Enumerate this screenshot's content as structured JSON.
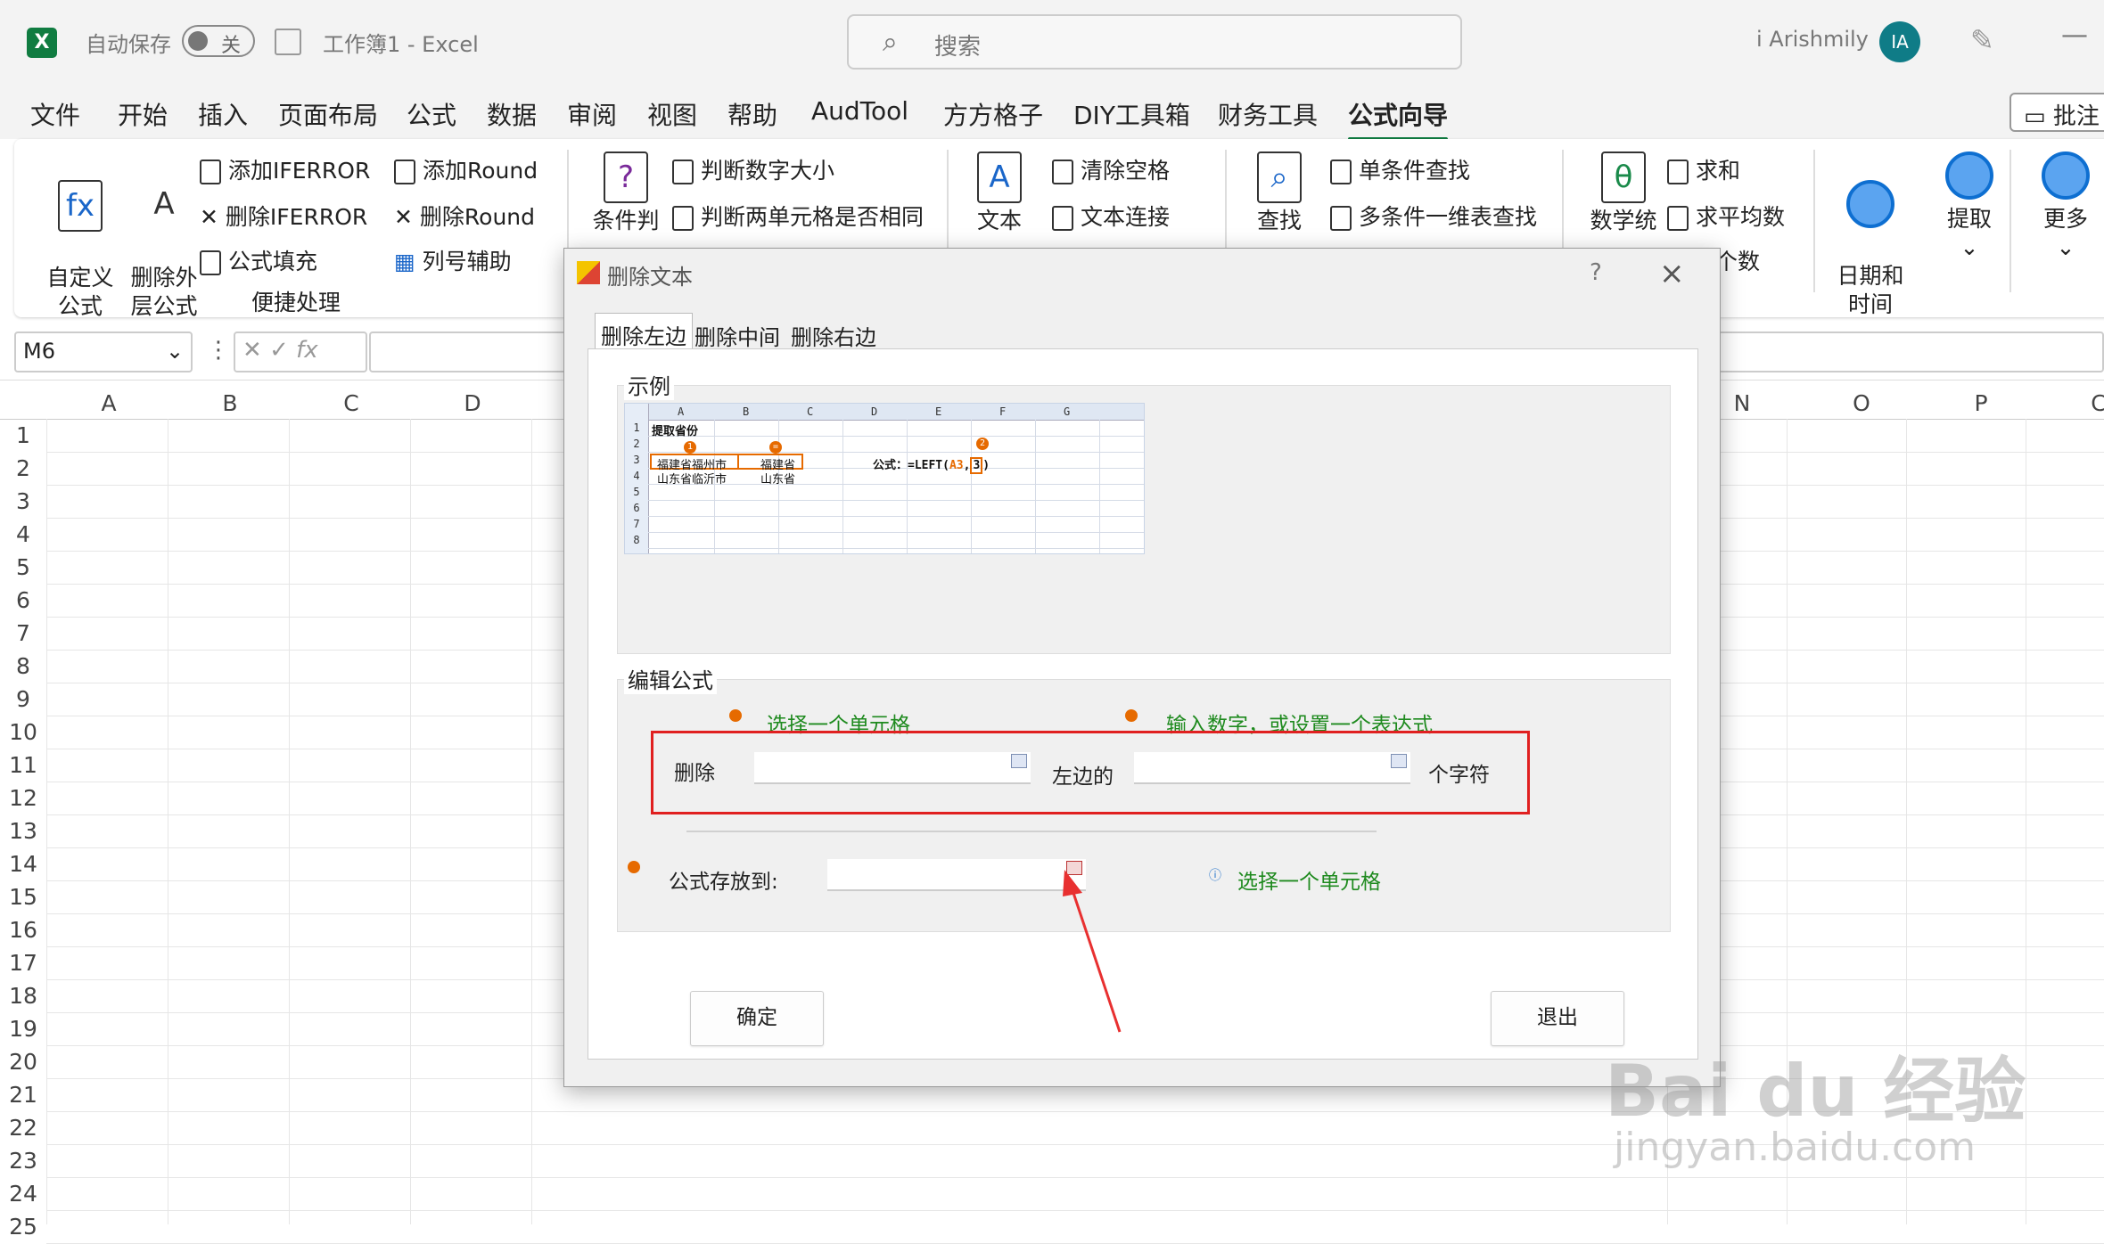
{
  "app": {
    "autosave_label": "自动保存",
    "autosave_state": "关",
    "doc_title": "工作簿1  -  Excel",
    "search_placeholder": "搜索",
    "user_name": "i Arishmily",
    "avatar_initials": "IA",
    "logo_letter": "X"
  },
  "menu": {
    "tabs": [
      "文件",
      "开始",
      "插入",
      "页面布局",
      "公式",
      "数据",
      "审阅",
      "视图",
      "帮助",
      "AudTool",
      "方方格子",
      "DIY工具箱",
      "财务工具",
      "公式向导"
    ],
    "active": "公式向导",
    "comment_label": "批注"
  },
  "ribbon": {
    "custom_formula": "自定义\n公式",
    "delete_outer": "删除外\n层公式",
    "add_iferror": "添加IFERROR",
    "del_iferror": "删除IFERROR",
    "formula_fill": "公式填充",
    "add_round": "添加Round",
    "del_round": "删除Round",
    "col_helper": "列号辅助",
    "group_quick": "便捷处理",
    "condition": "条件判",
    "judge_num_size": "判断数字大小",
    "judge_two_cells": "判断两单元格是否相同",
    "text": "文本",
    "clear_space": "清除空格",
    "text_concat": "文本连接",
    "lookup": "查找",
    "single_lookup": "单条件查找",
    "multi_lookup": "多条件一维表查找",
    "math_stats": "数学统",
    "sum": "求和",
    "average": "求平均数",
    "count_partial": "个数",
    "date_time": "日期和\n时间",
    "extract": "提取",
    "more": "更多"
  },
  "formula_bar": {
    "name_box": "M6",
    "fx": "fx"
  },
  "grid": {
    "columns": [
      "A",
      "B",
      "C",
      "D",
      "N",
      "O",
      "P",
      "C"
    ],
    "rows": [
      "1",
      "2",
      "3",
      "4",
      "5",
      "6",
      "7",
      "8",
      "9",
      "10",
      "11",
      "12",
      "13",
      "14",
      "15",
      "16",
      "17",
      "18",
      "19",
      "20",
      "21",
      "22",
      "23",
      "24",
      "25"
    ]
  },
  "dialog": {
    "title": "删除文本",
    "help": "?",
    "tabs": [
      "删除左边",
      "删除中间",
      "删除右边"
    ],
    "example_label": "示例",
    "edit_label": "编辑公式",
    "hint_select_cell": "选择一个单元格",
    "hint_input_number": "输入数字，或设置一个表达式",
    "delete_label": "删除",
    "left_of_label": "左边的",
    "chars_label": "个字符",
    "store_label": "公式存放到:",
    "store_hint": "选择一个单元格",
    "ok_button": "确定",
    "exit_button": "退出",
    "example": {
      "col_headers": [
        "A",
        "B",
        "C",
        "D",
        "E",
        "F",
        "G"
      ],
      "row_numbers": [
        "1",
        "2",
        "3",
        "4",
        "5",
        "6",
        "7",
        "8"
      ],
      "title_cell": "提取省份",
      "a3": "福建省福州市",
      "b3": "福建省",
      "a4": "山东省临沂市",
      "b4": "山东省",
      "formula_prefix": "公式：=LEFT(",
      "formula_ref": "A3",
      "formula_sep": ",",
      "formula_arg": "3",
      "formula_suffix": ")",
      "marker1": "1",
      "marker2": "2",
      "marker_eq": "="
    }
  },
  "watermark": {
    "main": "Bai du 经验",
    "sub": "jingyan.baidu.com"
  },
  "colors": {
    "excel_green": "#107c41",
    "hint_green": "#1e8a1e",
    "highlight_red": "#e02020",
    "bullet_orange": "#e66a00"
  }
}
